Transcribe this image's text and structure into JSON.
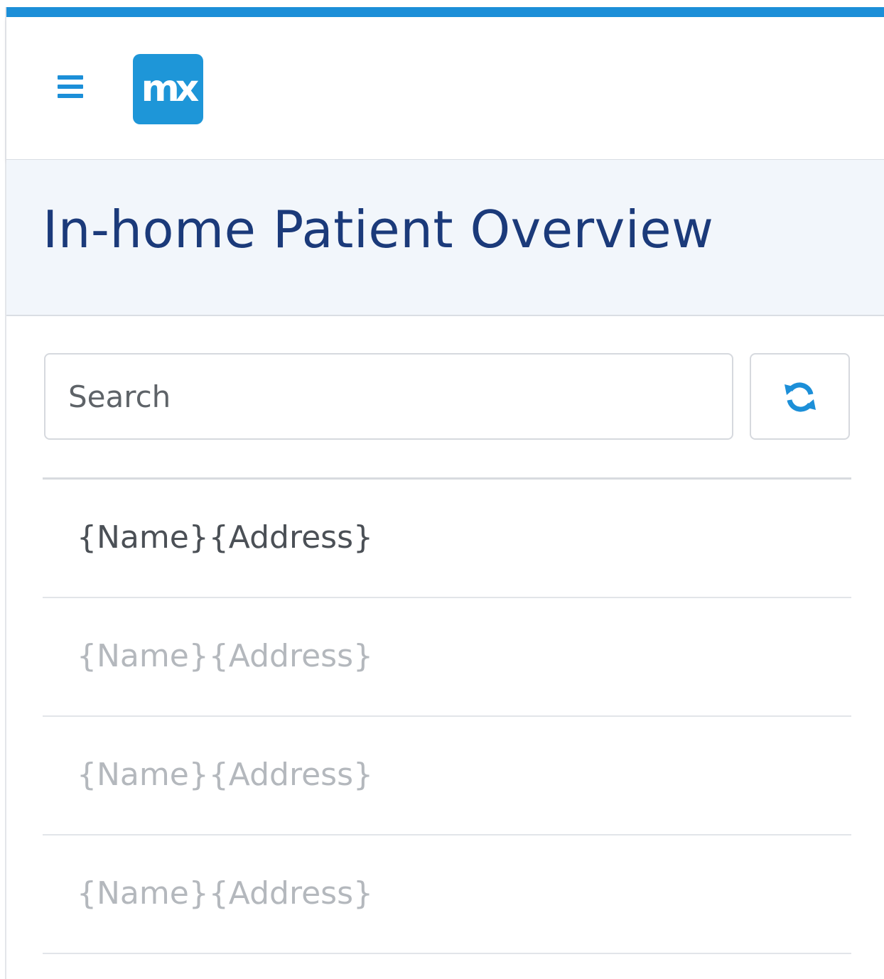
{
  "colors": {
    "accent": "#1c8fd8",
    "logo_bg": "#1e96d8",
    "title": "#1b3a7a",
    "header_bg": "#f2f6fb"
  },
  "topbar": {
    "menu_icon": "hamburger-menu-icon",
    "logo_text": "mx"
  },
  "page": {
    "title": "In-home Patient Overview"
  },
  "search": {
    "placeholder": "Search",
    "value": ""
  },
  "refresh": {
    "icon": "refresh-icon"
  },
  "list": {
    "items": [
      {
        "label": "{Name}{Address}"
      },
      {
        "label": "{Name}{Address}"
      },
      {
        "label": "{Name}{Address}"
      },
      {
        "label": "{Name}{Address}"
      }
    ]
  }
}
